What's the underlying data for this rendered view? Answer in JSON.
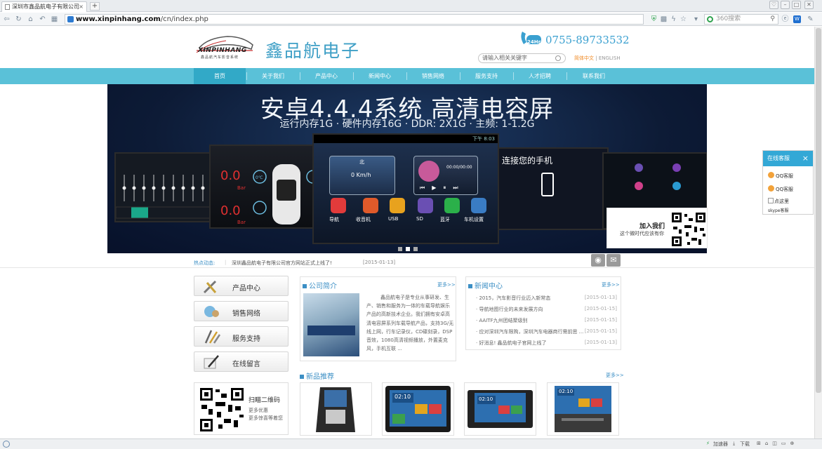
{
  "browser": {
    "tab_title": "深圳市鑫品航电子有限公司",
    "tab_close": "×",
    "new_tab": "+",
    "url_host": "www.xinpinhang.com",
    "url_path": "/cn/index.php",
    "search_placeholder": "360搜索"
  },
  "header": {
    "logo_en": "XINPINHANG",
    "logo_tagline": "鑫品航汽车影音系统",
    "logo_cn": "鑫品航电子",
    "phone_badge": "24Hr",
    "phone": "0755-89733532",
    "search_placeholder": "请输入相关关键字",
    "lang_cn": "简体中文",
    "lang_sep": "|",
    "lang_en": "ENGLISH"
  },
  "nav": {
    "items": [
      "首页",
      "关于我们",
      "产品中心",
      "新闻中心",
      "销售网络",
      "服务支持",
      "人才招聘",
      "联系我们"
    ]
  },
  "banner": {
    "title": "安卓4.4.4系统 高清电容屏",
    "subtitle": "运行内存1G · 硬件内存16G · DDR: 2X1G · 主频: 1-1.2G",
    "center_time": "下午 8:03",
    "compass": "北",
    "speed": "0 Km/h",
    "music_time": "00:00/00:00",
    "apps": [
      "导航",
      "收音机",
      "USB",
      "SD",
      "蓝牙",
      "车机设置"
    ],
    "tire_values": [
      "0.0",
      "0.0"
    ],
    "tire_unit": "Bar",
    "tire_temp": "0℃",
    "connect_title": "连接您的手机",
    "slide_count": 3,
    "active_slide": 1
  },
  "hotnews": {
    "label": "热点动态:",
    "text": "深圳鑫品航电子有限公司官方网站正式上线了!",
    "date": "[2015-01-13]"
  },
  "sidebar": {
    "buttons": [
      "产品中心",
      "销售网络",
      "服务支持",
      "在线留言"
    ],
    "qr_title": "扫瞄二维码",
    "qr_line1": "更多优惠",
    "qr_line2": "更多惊喜等着您"
  },
  "intro": {
    "title": "公司简介",
    "more": "更多>>",
    "text": "鑫品航电子是专业从事研发、生产、销售和服务为一体的车载导航娱乐产品的高新技术企业。我们拥有安卓高清电容屏系列车载导航产品，支持3G/无线上网，行车记录仪，CD碟刻录，DSP音效，1080高清视频播放，外置麦克风，手机互联 ..."
  },
  "news": {
    "title": "新闻中心",
    "more": "更多>>",
    "items": [
      {
        "text": "· 2015，汽车影音行业迈入新常态",
        "date": "[2015-01-13]"
      },
      {
        "text": "· 导航地图行业的未来发展方向",
        "date": "[2015-01-15]"
      },
      {
        "text": "· AAITF九州团结聚级别",
        "date": "[2015-01-15]"
      },
      {
        "text": "· 应对深圳汽车限购，深圳汽车电器商行需前思 ...",
        "date": "[2015-01-15]"
      },
      {
        "text": "· 好消息! 鑫品航电子官网上线了",
        "date": "[2015-01-13]"
      }
    ]
  },
  "products": {
    "title": "新品推荐",
    "more": "更多>>",
    "screen_time": "02:10"
  },
  "service": {
    "title": "在线客服",
    "close": "×",
    "qq1": "QQ客服",
    "qq2": "QQ客服",
    "click": "点这里",
    "skype": "skype客服"
  },
  "join": {
    "title": "加入我们",
    "subtitle": "这个微时代应该有你"
  },
  "status": {
    "accel": "加速器",
    "download": "下载"
  },
  "colors": {
    "nav": "#5ac1d8",
    "accent": "#3c8fc5",
    "service_header": "#33a8d6"
  }
}
